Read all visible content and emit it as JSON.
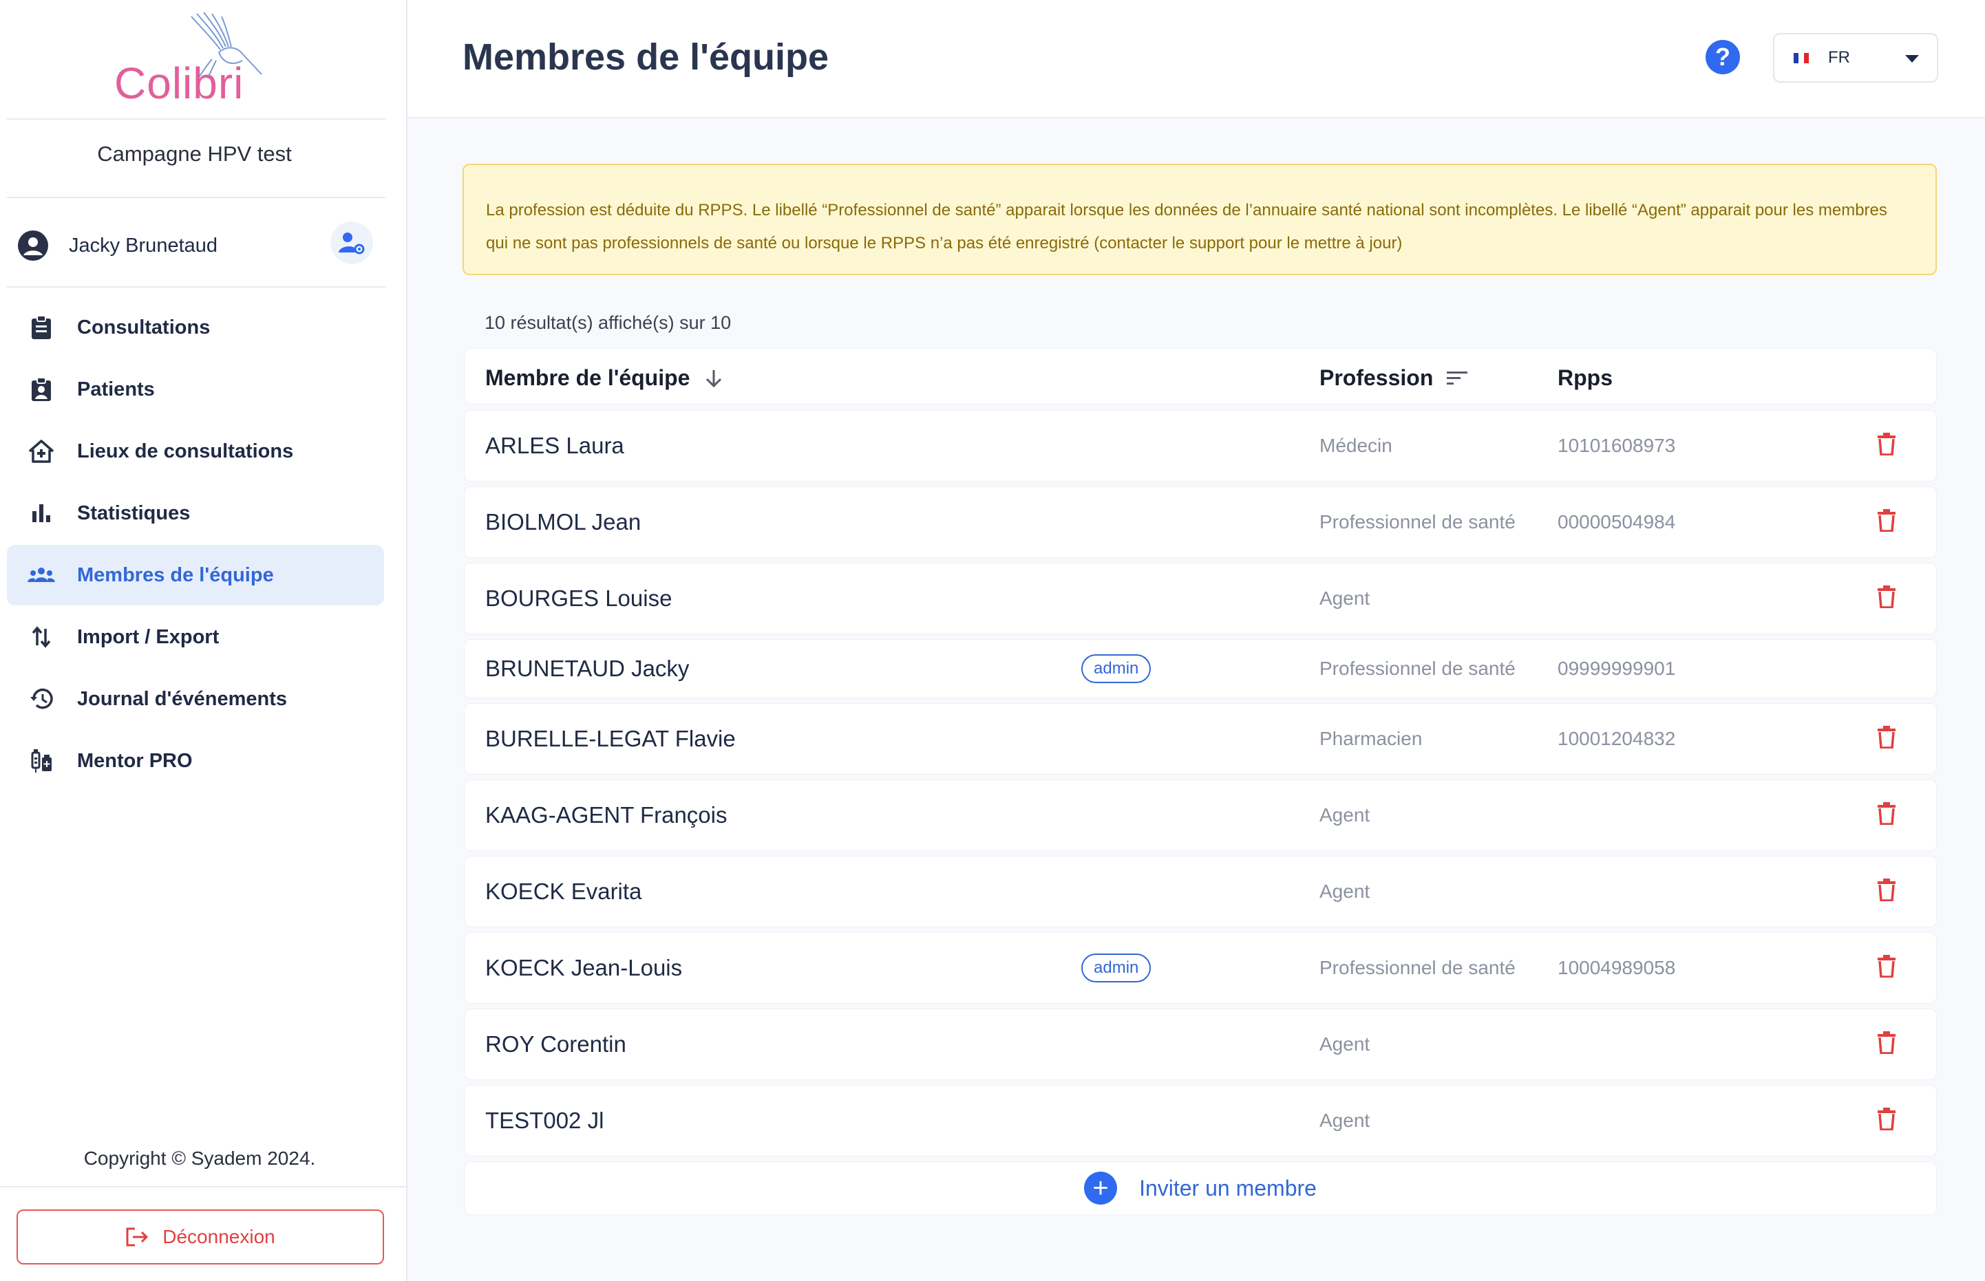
{
  "brand": {
    "logo_text": "Colibri"
  },
  "sidebar": {
    "campaign": "Campagne HPV test",
    "user_name": "Jacky Brunetaud",
    "items": [
      {
        "label": "Consultations",
        "icon": "clipboard-icon",
        "active": false
      },
      {
        "label": "Patients",
        "icon": "patient-badge-icon",
        "active": false
      },
      {
        "label": "Lieux de consultations",
        "icon": "home-plus-icon",
        "active": false
      },
      {
        "label": "Statistiques",
        "icon": "bar-chart-icon",
        "active": false
      },
      {
        "label": "Membres de l'équipe",
        "icon": "group-icon",
        "active": true
      },
      {
        "label": "Import / Export",
        "icon": "swap-vertical-icon",
        "active": false
      },
      {
        "label": "Journal d'événements",
        "icon": "history-icon",
        "active": false
      },
      {
        "label": "Mentor PRO",
        "icon": "vaccine-icon",
        "active": false
      }
    ],
    "copyright": "Copyright © Syadem 2024.",
    "logout_label": "Déconnexion"
  },
  "header": {
    "title": "Membres de l'équipe",
    "help_label": "?",
    "language": "FR"
  },
  "notice": "La profession est déduite du RPPS. Le libellé “Professionnel de santé” apparait lorsque les données de l’annuaire santé national sont incomplètes. Le libellé “Agent” apparait pour les membres qui ne sont pas professionnels de santé ou lorsque le RPPS n’a pas été enregistré (contacter le support pour le mettre à jour)",
  "results": "10 résultat(s) affiché(s) sur 10",
  "table": {
    "columns": [
      "Membre de l'équipe",
      "Profession",
      "Rpps"
    ],
    "rows": [
      {
        "name": "ARLES Laura",
        "badge": "",
        "profession": "Médecin",
        "rpps": "10101608973",
        "deletable": true
      },
      {
        "name": "BIOLMOL Jean",
        "badge": "",
        "profession": "Professionnel de santé",
        "rpps": "00000504984",
        "deletable": true
      },
      {
        "name": "BOURGES Louise",
        "badge": "",
        "profession": "Agent",
        "rpps": "",
        "deletable": true
      },
      {
        "name": "BRUNETAUD Jacky",
        "badge": "admin",
        "profession": "Professionnel de santé",
        "rpps": "09999999901",
        "deletable": false
      },
      {
        "name": "BURELLE-LEGAT Flavie",
        "badge": "",
        "profession": "Pharmacien",
        "rpps": "10001204832",
        "deletable": true
      },
      {
        "name": "KAAG-AGENT François",
        "badge": "",
        "profession": "Agent",
        "rpps": "",
        "deletable": true
      },
      {
        "name": "KOECK Evarita",
        "badge": "",
        "profession": "Agent",
        "rpps": "",
        "deletable": true
      },
      {
        "name": "KOECK Jean-Louis",
        "badge": "admin",
        "profession": "Professionnel de santé",
        "rpps": "10004989058",
        "deletable": true
      },
      {
        "name": "ROY Corentin",
        "badge": "",
        "profession": "Agent",
        "rpps": "",
        "deletable": true
      },
      {
        "name": "TEST002 Jl",
        "badge": "",
        "profession": "Agent",
        "rpps": "",
        "deletable": true
      }
    ],
    "invite_label": "Inviter un membre"
  },
  "colors": {
    "accent": "#3367d6",
    "danger": "#e04040",
    "notice_bg": "#fdf8d3"
  }
}
